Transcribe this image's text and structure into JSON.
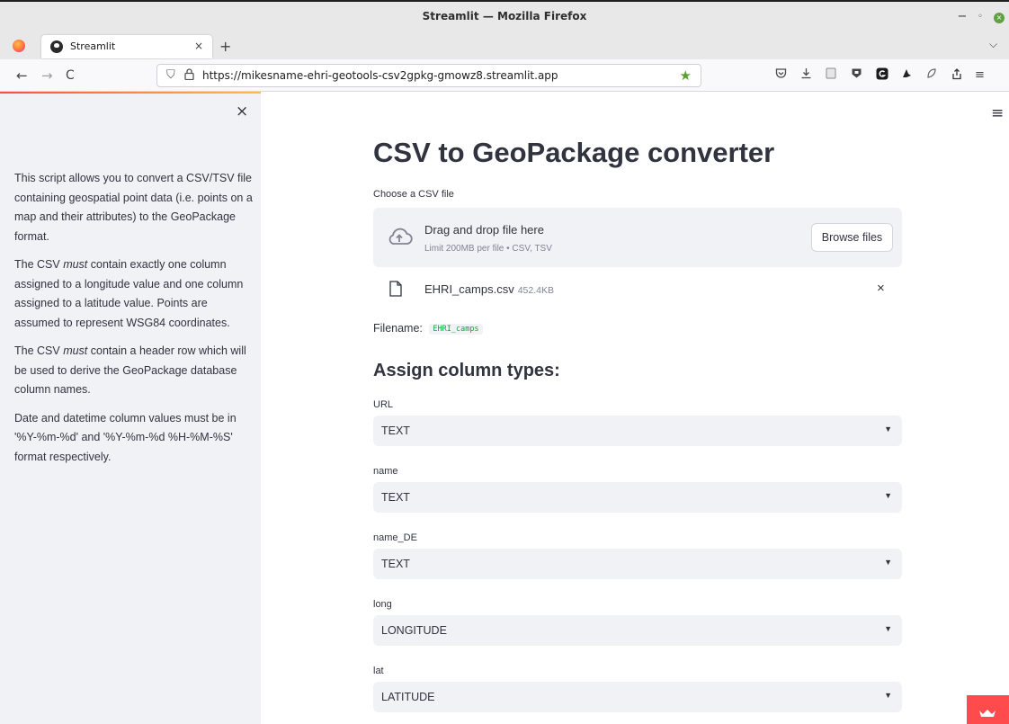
{
  "window": {
    "title": "Streamlit — Mozilla Firefox",
    "minimize": "−",
    "restore": "◦",
    "close": "×"
  },
  "tabs": [
    {
      "label": "Streamlit",
      "close": "×"
    }
  ],
  "tabbar": {
    "new_tab": "+",
    "list_all": "⌵"
  },
  "nav": {
    "back": "←",
    "forward": "→",
    "reload": "C",
    "url": "https://mikesname-ehri-geotools-csv2gpkg-gmowz8.streamlit.app",
    "bookmark_star": "★"
  },
  "toolbar_icons": [
    "pocket-icon",
    "download-icon",
    "reader-icon",
    "extension-shield-icon",
    "extension-g-icon",
    "extension-bird-icon",
    "extension-leaf-icon",
    "share-icon",
    "app-menu-icon"
  ],
  "sidebar": {
    "close": "×",
    "paragraphs": {
      "p1": "This script allows you to convert a CSV/TSV file containing geospatial point data (i.e. points on a map and their attributes) to the GeoPackage format.",
      "p2_before": "The CSV ",
      "p2_em": "must",
      "p2_after": " contain exactly one column assigned to a longitude value and one column assigned to a latitude value. Points are assumed to represent WSG84 coordinates.",
      "p3_before": "The CSV ",
      "p3_em": "must",
      "p3_after": " contain a header row which will be used to derive the GeoPackage database column names.",
      "p4": "Date and datetime column values must be in '%Y-%m-%d' and '%Y-%m-%d %H-%M-%S' format respectively."
    }
  },
  "main": {
    "menu": "≡",
    "title": "CSV to GeoPackage converter",
    "uploader": {
      "label": "Choose a CSV file",
      "drop_text": "Drag and drop file here",
      "limit_text": "Limit 200MB per file • CSV, TSV",
      "browse_label": "Browse files"
    },
    "uploaded_file": {
      "name": "EHRI_camps.csv",
      "size": "452.4KB",
      "remove": "×"
    },
    "filename": {
      "label": "Filename:",
      "value": "EHRI_camps"
    },
    "section_title": "Assign column types:",
    "columns": [
      {
        "label": "URL",
        "value": "TEXT"
      },
      {
        "label": "name",
        "value": "TEXT"
      },
      {
        "label": "name_DE",
        "value": "TEXT"
      },
      {
        "label": "long",
        "value": "LONGITUDE"
      },
      {
        "label": "lat",
        "value": "LATITUDE"
      }
    ],
    "caret": "▼"
  },
  "colors": {
    "sidebar_bg": "#f0f2f6",
    "text": "#31333f",
    "accent_red": "#ff4b4b",
    "code_green": "#09ab3b",
    "bookmark_green": "#5aa02c"
  }
}
